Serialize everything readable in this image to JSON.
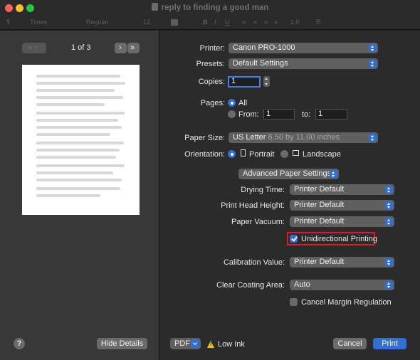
{
  "window": {
    "title": "reply to finding a good man"
  },
  "toolbar": {
    "paragraph_glyph": "¶",
    "font_family": "Times",
    "font_style": "Regular",
    "font_size": "12",
    "bold": "B",
    "italic": "I",
    "underline": "U",
    "line_spacing": "1.0"
  },
  "preview": {
    "page_indicator": "1 of 3",
    "prev_glyph": "« ‹",
    "next_glyph": "›",
    "last_glyph": "»",
    "help_label": "?",
    "hide_details_label": "Hide Details"
  },
  "printer": {
    "label": "Printer:",
    "value": "Canon PRO-1000"
  },
  "presets": {
    "label": "Presets:",
    "value": "Default Settings"
  },
  "copies": {
    "label": "Copies:",
    "value": "1"
  },
  "pages": {
    "label": "Pages:",
    "all_label": "All",
    "from_label": "From:",
    "from_value": "1",
    "to_label": "to:",
    "to_value": "1",
    "selected": "All"
  },
  "paper_size": {
    "label": "Paper Size:",
    "value": "US Letter",
    "dimensions": "8.50 by 11.00 inches"
  },
  "orientation": {
    "label": "Orientation:",
    "portrait_label": "Portrait",
    "landscape_label": "Landscape",
    "selected": "Portrait"
  },
  "section": {
    "value": "Advanced Paper Settings"
  },
  "drying_time": {
    "label": "Drying Time:",
    "value": "Printer Default"
  },
  "print_head_height": {
    "label": "Print Head Height:",
    "value": "Printer Default"
  },
  "paper_vacuum": {
    "label": "Paper Vacuum:",
    "value": "Printer Default"
  },
  "unidirectional": {
    "label": "Unidirectional Printing",
    "checked": true
  },
  "calibration": {
    "label": "Calibration Value:",
    "value": "Printer Default"
  },
  "clear_coating": {
    "label": "Clear Coating Area:",
    "value": "Auto"
  },
  "cancel_margin": {
    "label": "Cancel Margin Regulation",
    "checked": false
  },
  "footer": {
    "pdf_label": "PDF",
    "warning_glyph": "!",
    "low_ink_label": "Low Ink",
    "cancel_label": "Cancel",
    "print_label": "Print"
  },
  "colors": {
    "accent": "#2f6fd6",
    "highlight": "#e11d1d",
    "warning": "#f5c518"
  }
}
